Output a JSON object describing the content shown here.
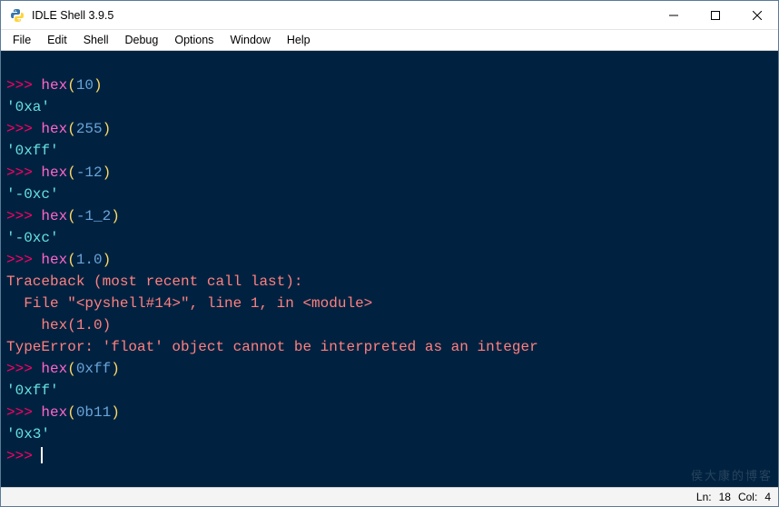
{
  "window": {
    "title": "IDLE Shell 3.9.5"
  },
  "menubar": {
    "items": [
      "File",
      "Edit",
      "Shell",
      "Debug",
      "Options",
      "Window",
      "Help"
    ]
  },
  "lines": [
    [
      {
        "cls": "prompt",
        "t": ">>> "
      },
      {
        "cls": "func",
        "t": "hex"
      },
      {
        "cls": "punct",
        "t": "("
      },
      {
        "cls": "num",
        "t": "10"
      },
      {
        "cls": "punct",
        "t": ")"
      }
    ],
    [
      {
        "cls": "str",
        "t": "'0xa'"
      }
    ],
    [
      {
        "cls": "prompt",
        "t": ">>> "
      },
      {
        "cls": "func",
        "t": "hex"
      },
      {
        "cls": "punct",
        "t": "("
      },
      {
        "cls": "num",
        "t": "255"
      },
      {
        "cls": "punct",
        "t": ")"
      }
    ],
    [
      {
        "cls": "str",
        "t": "'0xff'"
      }
    ],
    [
      {
        "cls": "prompt",
        "t": ">>> "
      },
      {
        "cls": "func",
        "t": "hex"
      },
      {
        "cls": "punct",
        "t": "("
      },
      {
        "cls": "num",
        "t": "-12"
      },
      {
        "cls": "punct",
        "t": ")"
      }
    ],
    [
      {
        "cls": "str",
        "t": "'-0xc'"
      }
    ],
    [
      {
        "cls": "prompt",
        "t": ">>> "
      },
      {
        "cls": "func",
        "t": "hex"
      },
      {
        "cls": "punct",
        "t": "("
      },
      {
        "cls": "num",
        "t": "-1_2"
      },
      {
        "cls": "punct",
        "t": ")"
      }
    ],
    [
      {
        "cls": "str",
        "t": "'-0xc'"
      }
    ],
    [
      {
        "cls": "prompt",
        "t": ">>> "
      },
      {
        "cls": "func",
        "t": "hex"
      },
      {
        "cls": "punct",
        "t": "("
      },
      {
        "cls": "num",
        "t": "1.0"
      },
      {
        "cls": "punct",
        "t": ")"
      }
    ],
    [
      {
        "cls": "err",
        "t": "Traceback (most recent call last):"
      }
    ],
    [
      {
        "cls": "err",
        "t": "  File \"<pyshell#14>\", line 1, in <module>"
      }
    ],
    [
      {
        "cls": "err",
        "t": "    hex(1.0)"
      }
    ],
    [
      {
        "cls": "err",
        "t": "TypeError: 'float' object cannot be interpreted as an integer"
      }
    ],
    [
      {
        "cls": "prompt",
        "t": ">>> "
      },
      {
        "cls": "func",
        "t": "hex"
      },
      {
        "cls": "punct",
        "t": "("
      },
      {
        "cls": "num",
        "t": "0xff"
      },
      {
        "cls": "punct",
        "t": ")"
      }
    ],
    [
      {
        "cls": "str",
        "t": "'0xff'"
      }
    ],
    [
      {
        "cls": "prompt",
        "t": ">>> "
      },
      {
        "cls": "func",
        "t": "hex"
      },
      {
        "cls": "punct",
        "t": "("
      },
      {
        "cls": "num",
        "t": "0b11"
      },
      {
        "cls": "punct",
        "t": ")"
      }
    ],
    [
      {
        "cls": "str",
        "t": "'0x3'"
      }
    ],
    [
      {
        "cls": "prompt",
        "t": ">>> "
      },
      {
        "cls": "cursor",
        "t": ""
      }
    ]
  ],
  "watermark": "侯大康的博客",
  "statusbar": {
    "line_label": "Ln:",
    "line": "18",
    "col_label": "Col:",
    "col": "4"
  }
}
